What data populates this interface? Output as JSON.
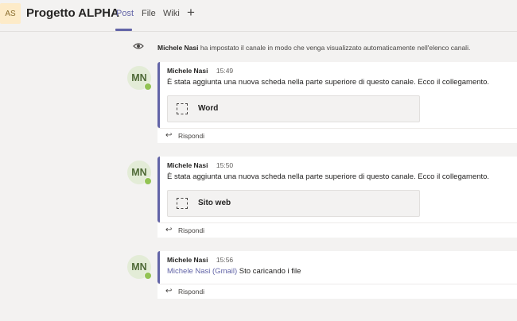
{
  "header": {
    "team_initials": "AS",
    "channel_name": "Progetto ALPHA",
    "tabs": [
      {
        "label": "Post"
      },
      {
        "label": "File"
      },
      {
        "label": "Wiki"
      }
    ],
    "add_tab_symbol": "+"
  },
  "system_message": {
    "icon": "eye-icon",
    "author": "Michele Nasi",
    "text": " ha impostato il canale in modo che venga visualizzato automaticamente nell'elenco canali."
  },
  "messages": [
    {
      "initials": "MN",
      "author": "Michele Nasi",
      "time": "15:49",
      "text": "È stata aggiunta una nuova scheda nella parte superiore di questo canale. Ecco il collegamento.",
      "attachment": "Word",
      "reply_label": "Rispondi"
    },
    {
      "initials": "MN",
      "author": "Michele Nasi",
      "time": "15:50",
      "text": "È stata aggiunta una nuova scheda nella parte superiore di questo canale. Ecco il collegamento.",
      "attachment": "Sito web",
      "reply_label": "Rispondi"
    },
    {
      "initials": "MN",
      "author": "Michele Nasi",
      "time": "15:56",
      "mention": "Michele Nasi (Gmail)",
      "text": " Sto caricando i file",
      "reply_label": "Rispondi"
    }
  ],
  "colors": {
    "accent": "#6264a7",
    "presence_available": "#92c353",
    "background": "#f3f2f1"
  }
}
